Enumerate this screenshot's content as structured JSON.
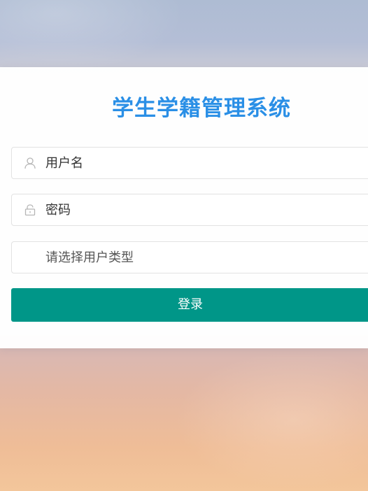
{
  "login": {
    "title": "学生学籍管理系统",
    "username_placeholder": "用户名",
    "password_placeholder": "密码",
    "user_type_placeholder": "请选择用户类型",
    "submit_label": "登录"
  },
  "icons": {
    "username": "user-icon",
    "password": "lock-icon"
  },
  "colors": {
    "title": "#2a8fe6",
    "button": "#009688",
    "button_text": "#ffffff"
  }
}
